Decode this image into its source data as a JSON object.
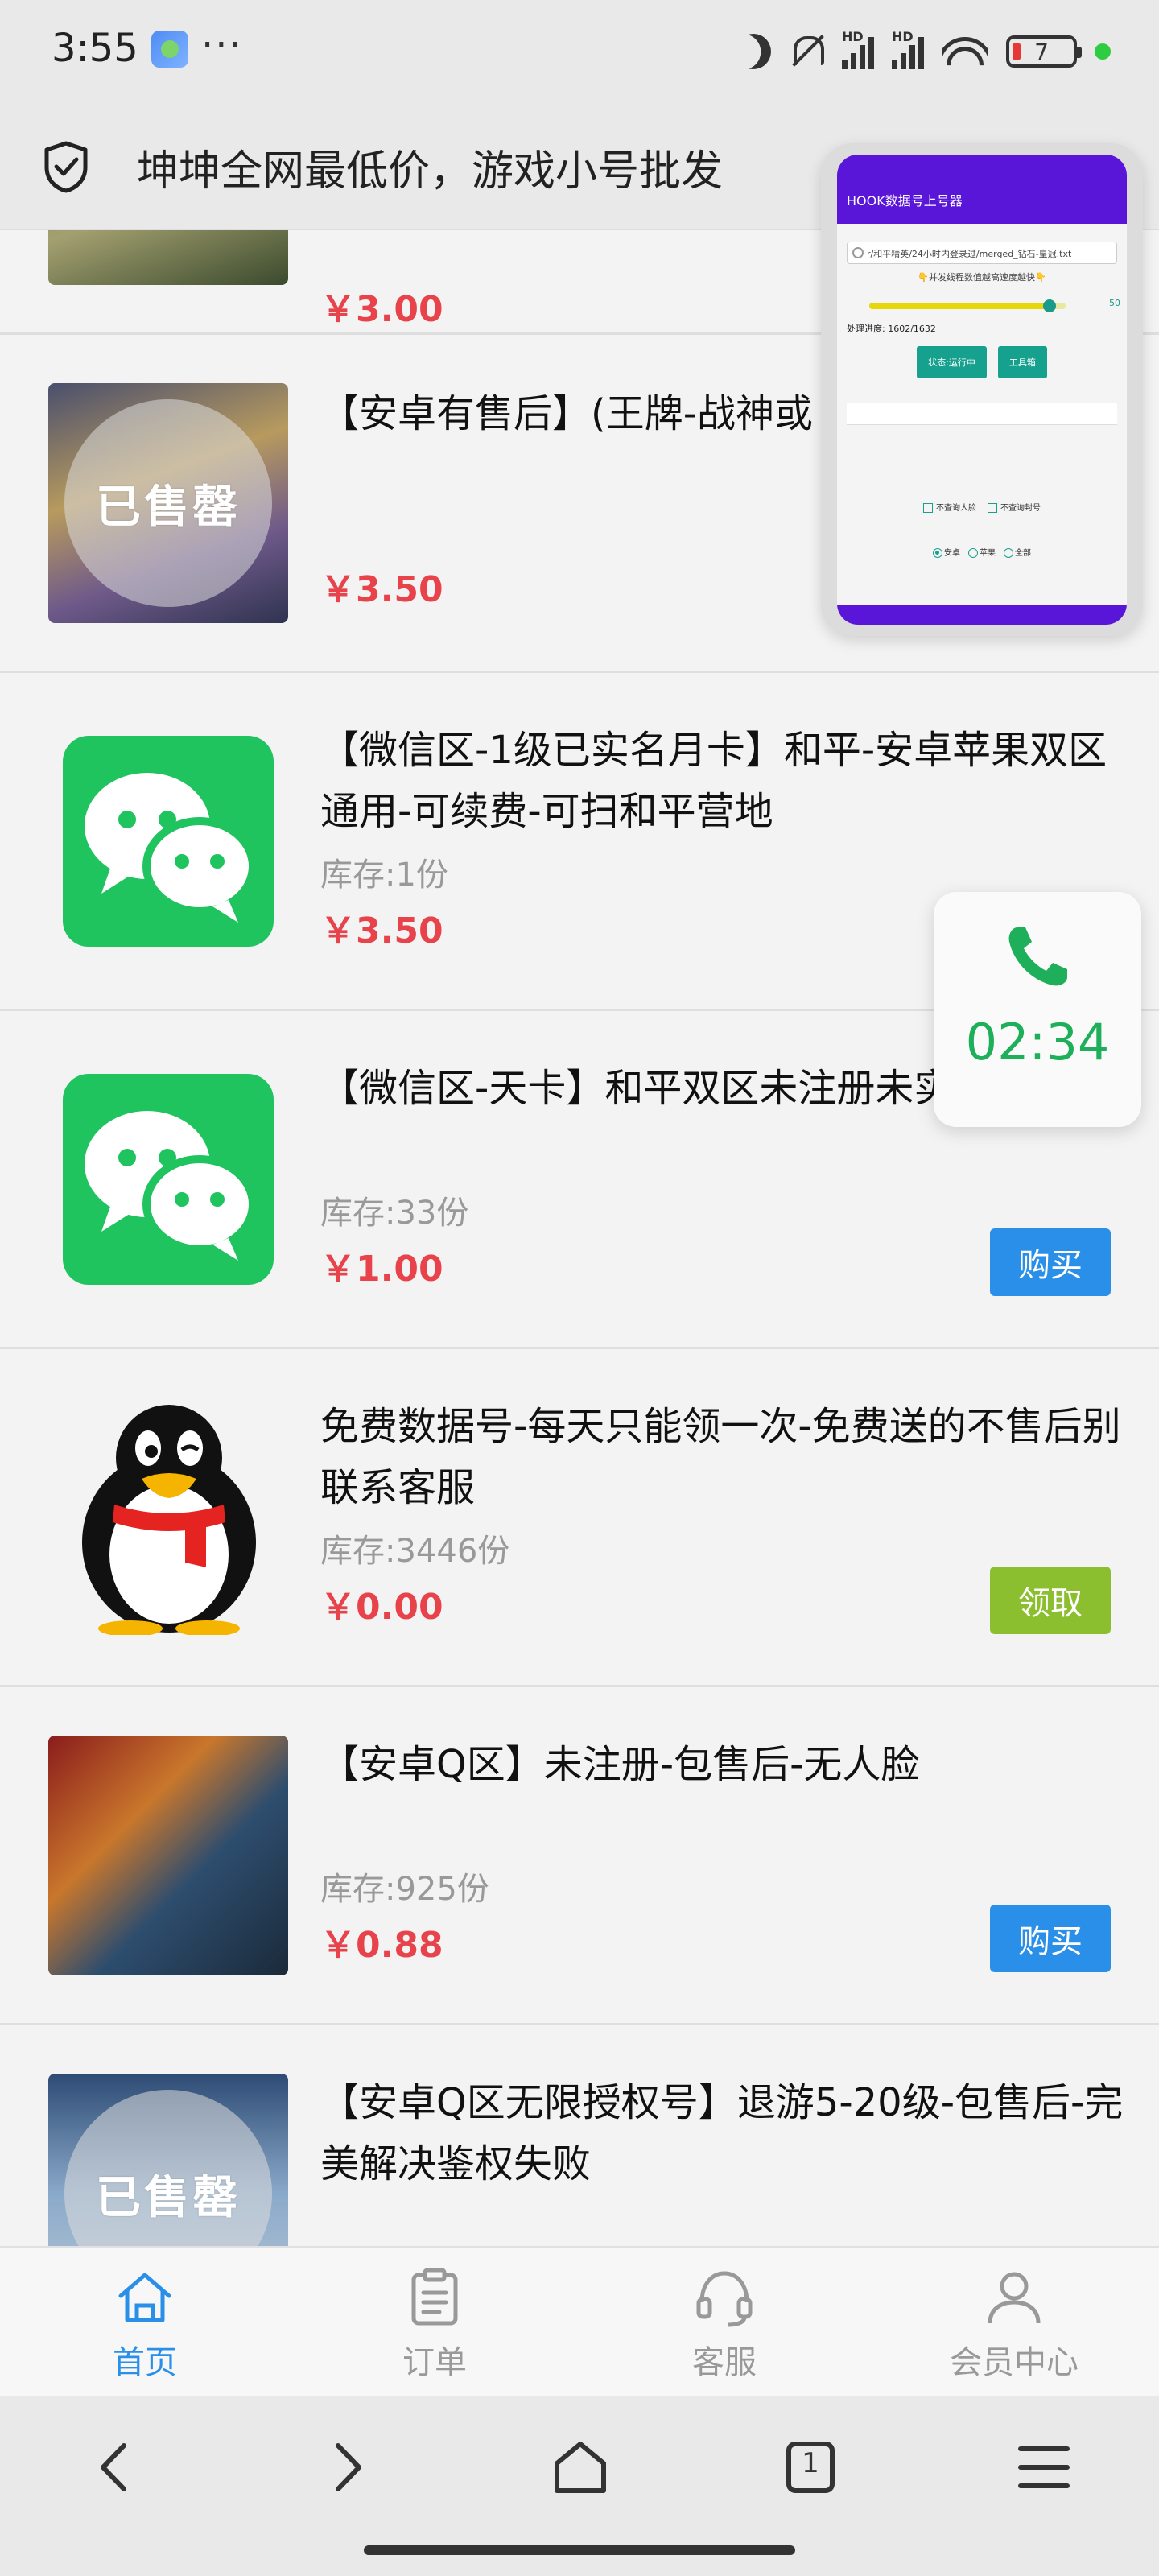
{
  "status_bar": {
    "time": "3:55",
    "dots": "···",
    "battery": "7",
    "hd1": "HD",
    "hd2": "HD"
  },
  "header": {
    "title": "坤坤全网最低价，游戏小号批发"
  },
  "items": [
    {
      "title": "",
      "stock": "",
      "price": "￥3.00",
      "sold_out": false,
      "button": ""
    },
    {
      "title": "【安卓有售后】(王牌-战神或",
      "stock": "",
      "price": "￥3.50",
      "sold_out": true,
      "sold_out_label": "已售罄",
      "button": ""
    },
    {
      "title": "【微信区-1级已实名月卡】和平-安卓苹果双区通用-可续费-可扫和平营地",
      "stock": "库存:1份",
      "price": "￥3.50",
      "button": ""
    },
    {
      "title": "【微信区-天卡】和平双区未注册未实名包售后",
      "stock": "库存:33份",
      "price": "￥1.00",
      "button": "购买"
    },
    {
      "title": "免费数据号-每天只能领一次-免费送的不售后别联系客服",
      "stock": "库存:3446份",
      "price": "￥0.00",
      "button": "领取"
    },
    {
      "title": "【安卓Q区】未注册-包售后-无人脸",
      "stock": "库存:925份",
      "price": "￥0.88",
      "button": "购买"
    },
    {
      "title": "【安卓Q区无限授权号】退游5-20级-包售后-完美解决鉴权失败",
      "stock": "",
      "price": "",
      "sold_out": true,
      "sold_out_label": "已售罄",
      "button": ""
    }
  ],
  "call_widget": {
    "time": "02:34"
  },
  "mini_window": {
    "title": "HOOK数据号上号器",
    "path": "r/和平精英/24小时内登录过/merged_钻石-皇冠.txt",
    "tip": "👇并发线程数值越高速度越快👇",
    "slider_value": 50,
    "slider_fraction": 0.92,
    "progress_text": "处理进度: 1602/1632",
    "btn_status": "状态:运行中",
    "btn_tools": "工具箱",
    "check_face": "不查询人脸",
    "check_ban": "不查询封号",
    "radio_android": "安卓",
    "radio_apple": "苹果",
    "radio_all": "全部"
  },
  "tabbar": [
    {
      "label": "首页",
      "active": true
    },
    {
      "label": "订单",
      "active": false
    },
    {
      "label": "客服",
      "active": false
    },
    {
      "label": "会员中心",
      "active": false
    }
  ],
  "nav": {
    "tab_count": "1"
  },
  "colors": {
    "accent": "#2a8fe8",
    "price": "#e8424a",
    "green_button": "#8bbf2f",
    "call_green": "#1eaf5a",
    "mini_header": "#5a16d8"
  }
}
